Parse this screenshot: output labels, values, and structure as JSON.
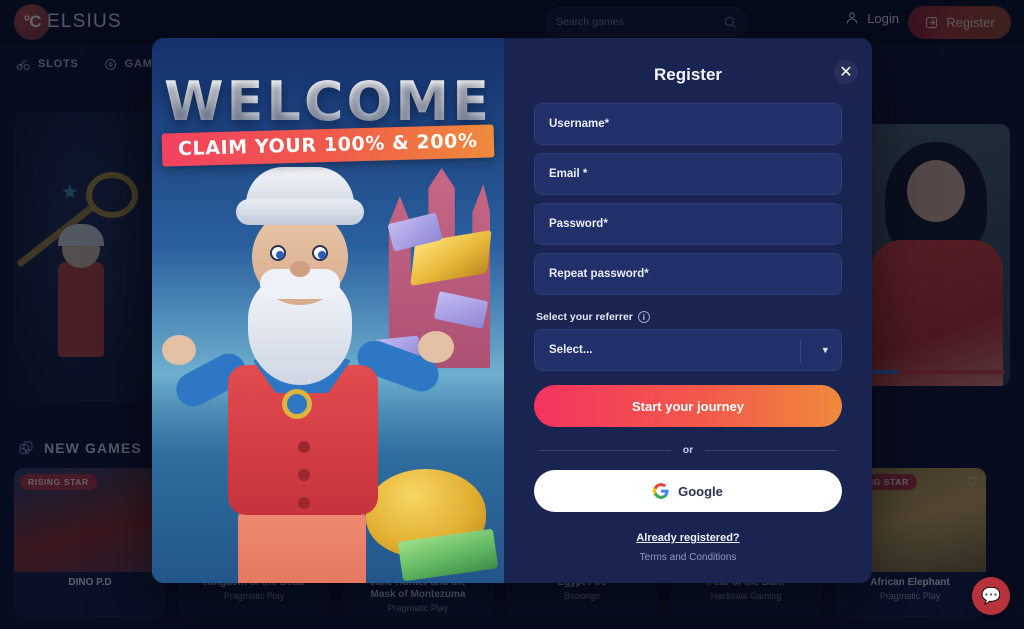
{
  "header": {
    "logo_symbol": "°C",
    "logo_text": "ELSIUS",
    "search_placeholder": "Search games",
    "search_value": "",
    "search_icon": "search-icon",
    "login_label": "Login",
    "login_icon": "user-icon",
    "register_label": "Register",
    "register_icon": "login-arrow-icon"
  },
  "nav": {
    "items": [
      {
        "label": "SLOTS",
        "icon": "slots-icon"
      },
      {
        "label": "GAME SHOWS",
        "icon": "game-shows-icon"
      }
    ]
  },
  "sections": {
    "new_games": {
      "title": "NEW GAMES",
      "icon": "dice-icon"
    }
  },
  "games": [
    {
      "title": "DINO P.D",
      "provider": "",
      "badge": "RISING STAR",
      "art": "art-a",
      "info": "i"
    },
    {
      "title": "Kingdom of the Dead",
      "provider": "Pragmatic Play",
      "badge": "",
      "art": "art-b",
      "info": "i"
    },
    {
      "title": "Jane Hunter and the Mask of Montezuma",
      "provider": "Pragmatic Play",
      "badge": "",
      "art": "art-c",
      "info": "i"
    },
    {
      "title": "Egypt Fire",
      "provider": "Booongo",
      "badge": "",
      "art": "art-d",
      "info": "i"
    },
    {
      "title": "Fear of the Dark",
      "provider": "Hacksaw Gaming",
      "badge": "",
      "art": "art-e",
      "info": "i"
    },
    {
      "title": "African Elephant",
      "provider": "Pragmatic Play",
      "badge": "RISING STAR",
      "art": "art-f",
      "info": "i"
    }
  ],
  "promo": {
    "headline": "WELCOME",
    "ribbon": "CLAIM YOUR 100% & 200%"
  },
  "modal": {
    "title": "Register",
    "close_icon": "close-icon",
    "fields": [
      {
        "name": "username",
        "placeholder": "Username*",
        "value": "",
        "type": "text"
      },
      {
        "name": "email",
        "placeholder": "Email *",
        "value": "",
        "type": "text"
      },
      {
        "name": "password",
        "placeholder": "Password*",
        "value": "",
        "type": "password"
      },
      {
        "name": "repeat_password",
        "placeholder": "Repeat password*",
        "value": "",
        "type": "password"
      }
    ],
    "referrer_label": "Select your referrer",
    "referrer_info_icon": "info-icon",
    "referrer_value": "Select...",
    "referrer_chevron": "chevron-down-icon",
    "submit_label": "Start your journey",
    "divider_text": "or",
    "google_label": "Google",
    "google_icon": "google-icon",
    "already_registered": "Already registered?",
    "terms": "Terms and Conditions"
  },
  "chat": {
    "icon": "chat-bubble-icon"
  },
  "colors": {
    "page_bg": "#0d1330",
    "topbar_bg": "#0b1126",
    "modal_bg": "#1a2450",
    "field_bg": "#22306a",
    "accent_start": "#f5345f",
    "accent_end": "#ef8a3c",
    "badge_red": "#b0323f"
  }
}
